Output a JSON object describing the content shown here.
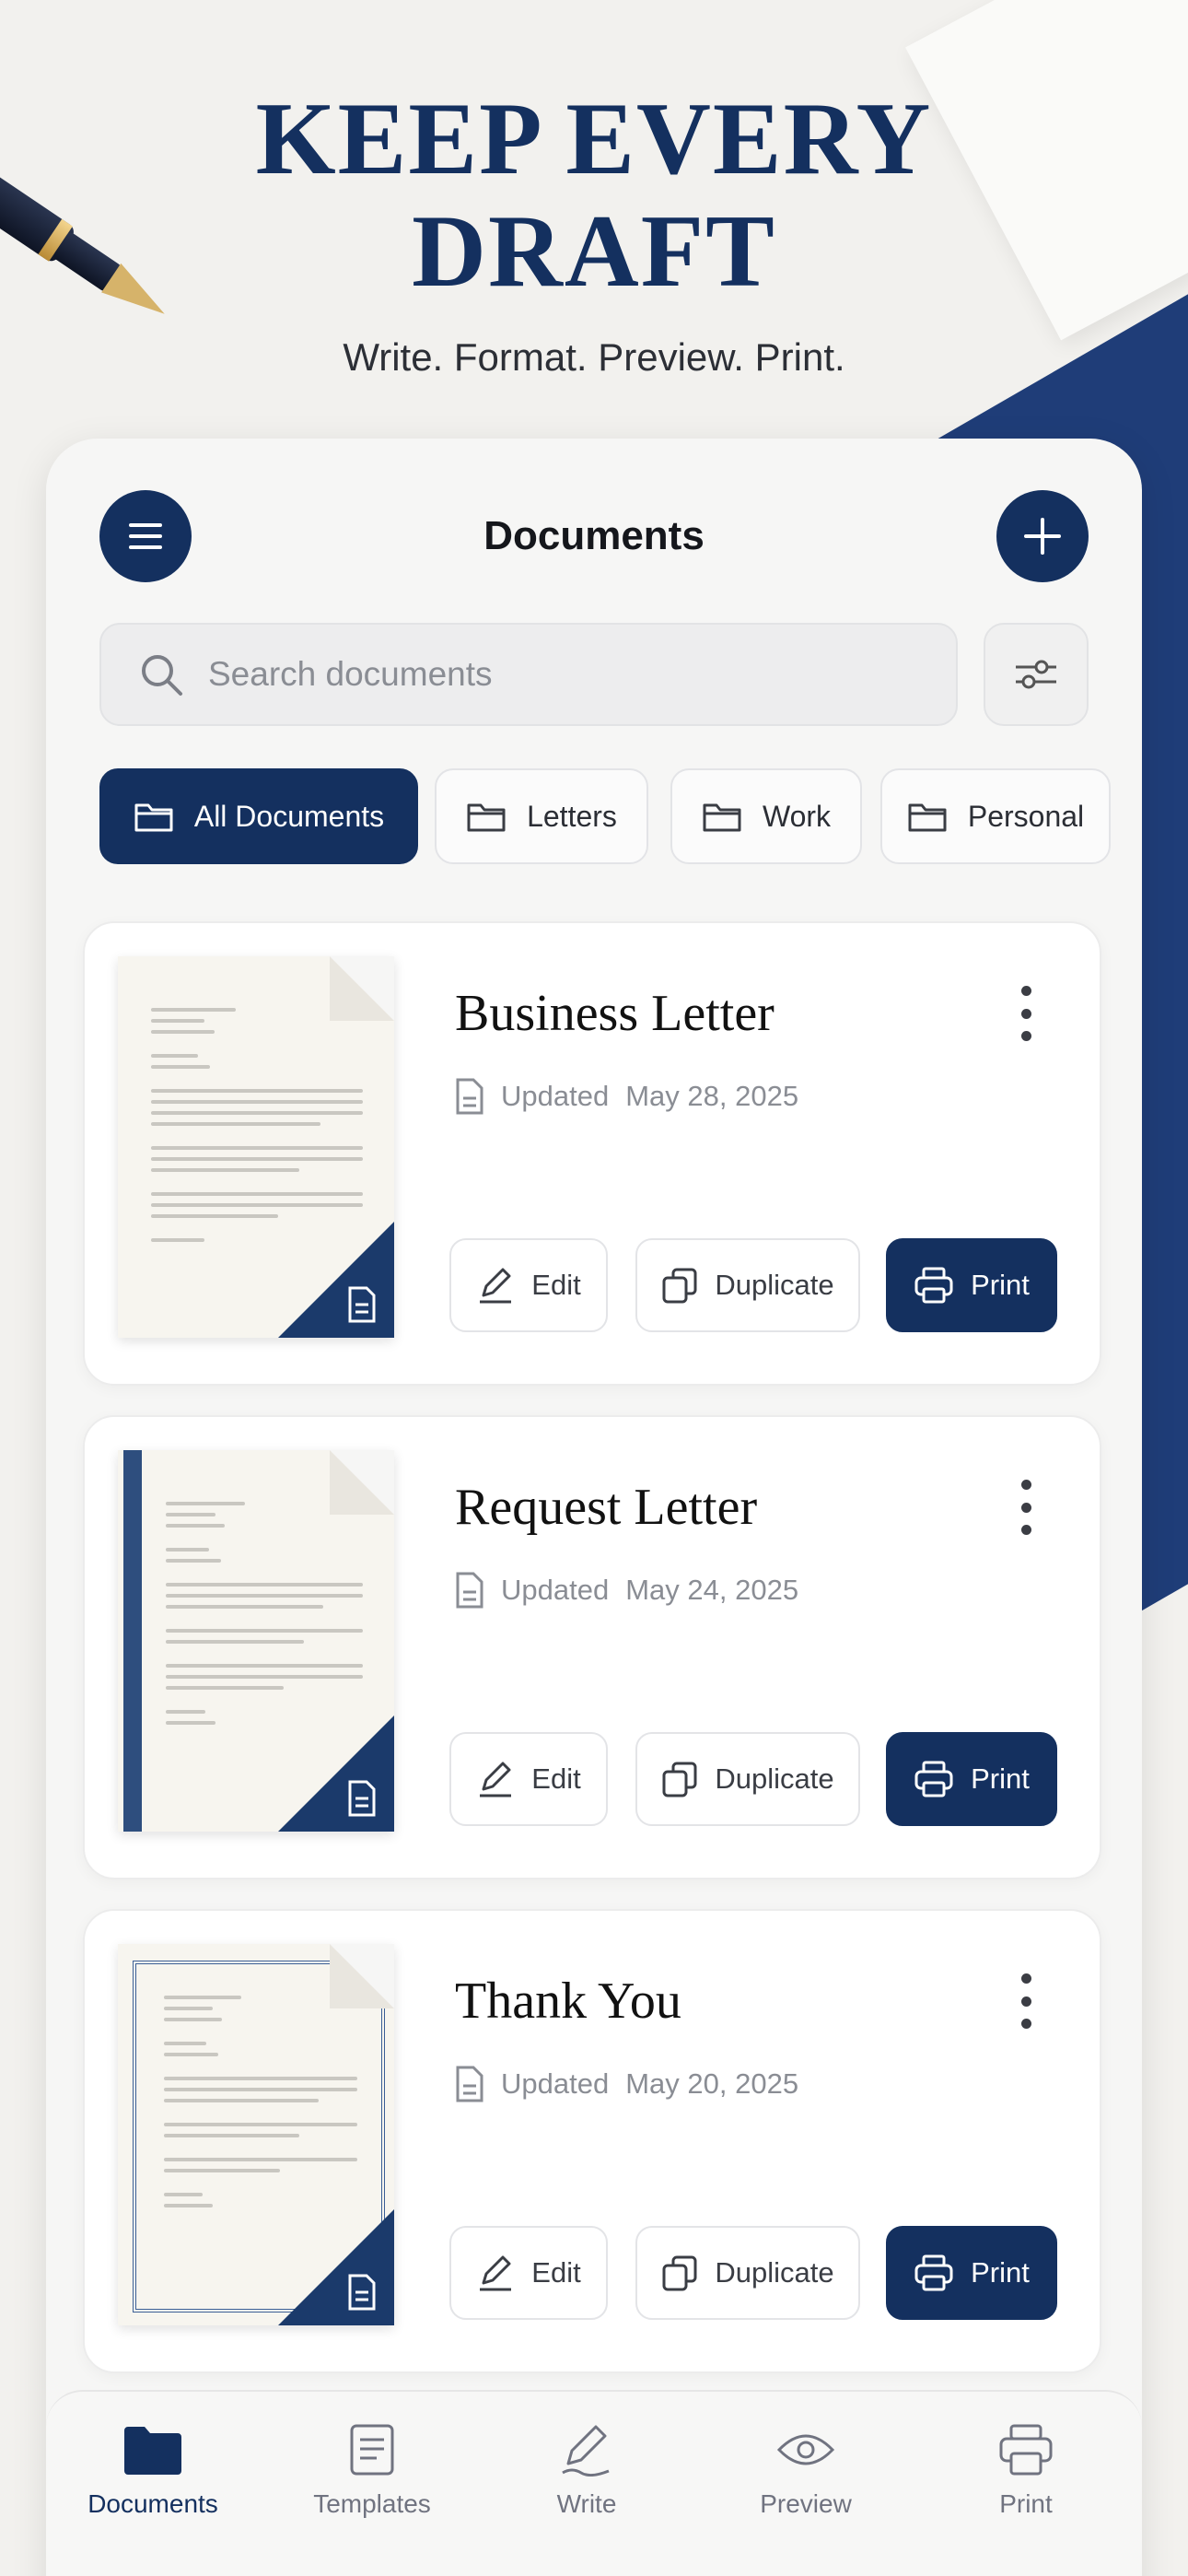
{
  "hero": {
    "title": "KEEP EVERY DRAFT",
    "tagline": "Write. Format. Preview. Print."
  },
  "header": {
    "title": "Documents",
    "menu_icon": "hamburger-icon",
    "add_icon": "plus-icon"
  },
  "search": {
    "placeholder": "Search documents",
    "icon": "search-icon",
    "filter_icon": "sliders-icon"
  },
  "categories": [
    {
      "label": "All Documents",
      "active": true,
      "icon": "folder-icon"
    },
    {
      "label": "Letters",
      "active": false,
      "icon": "folder-icon"
    },
    {
      "label": "Work",
      "active": false,
      "icon": "folder-icon"
    },
    {
      "label": "Personal",
      "active": false,
      "icon": "folder-icon"
    }
  ],
  "documents": [
    {
      "title": "Business Letter",
      "updated_label": "Updated",
      "updated_date": "May 28, 2025",
      "actions": {
        "edit": "Edit",
        "duplicate": "Duplicate",
        "print": "Print"
      },
      "thumbnail_style": "plain"
    },
    {
      "title": "Request Letter",
      "updated_label": "Updated",
      "updated_date": "May 24, 2025",
      "actions": {
        "edit": "Edit",
        "duplicate": "Duplicate",
        "print": "Print"
      },
      "thumbnail_style": "stripe"
    },
    {
      "title": "Thank You",
      "updated_label": "Updated",
      "updated_date": "May 20, 2025",
      "actions": {
        "edit": "Edit",
        "duplicate": "Duplicate",
        "print": "Print"
      },
      "thumbnail_style": "ornate-border"
    }
  ],
  "tabs": [
    {
      "label": "Documents",
      "icon": "folder-icon",
      "active": true
    },
    {
      "label": "Templates",
      "icon": "template-icon",
      "active": false
    },
    {
      "label": "Write",
      "icon": "pen-icon",
      "active": false
    },
    {
      "label": "Preview",
      "icon": "eye-icon",
      "active": false
    },
    {
      "label": "Print",
      "icon": "printer-icon",
      "active": false
    }
  ],
  "colors": {
    "primary": "#14305f",
    "accent_blue": "#1f3d78",
    "background": "#f2f1ee",
    "muted_text": "#8a8d94"
  }
}
